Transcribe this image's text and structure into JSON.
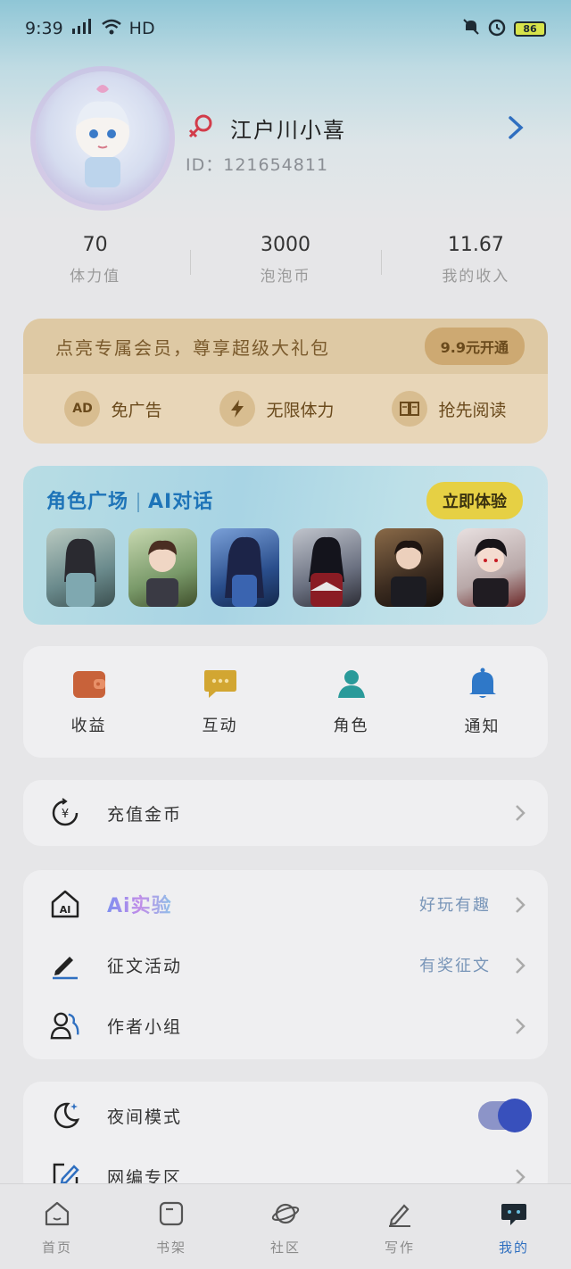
{
  "status_bar": {
    "time": "9:39",
    "network": "HD",
    "battery": "86"
  },
  "profile": {
    "nickname": "江户川小喜",
    "id_text": "ID：121654811"
  },
  "stats": [
    {
      "value": "70",
      "label": "体力值"
    },
    {
      "value": "3000",
      "label": "泡泡币"
    },
    {
      "value": "11.67",
      "label": "我的收入"
    }
  ],
  "vip": {
    "promo_text": "点亮专属会员，尊享超级大礼包",
    "button": "9.9元开通",
    "perks": [
      {
        "icon": "ad-icon",
        "icon_text": "AD",
        "label": "免广告"
      },
      {
        "icon": "lightning-icon",
        "label": "无限体力"
      },
      {
        "icon": "book-icon",
        "label": "抢先阅读"
      }
    ]
  },
  "role_plaza": {
    "title_left": "角色广场",
    "title_right": "AI对话",
    "button": "立即体验",
    "thumb_count": 6
  },
  "quick_actions": [
    {
      "label": "收益",
      "icon": "wallet-icon",
      "color": "#c8623a"
    },
    {
      "label": "互动",
      "icon": "chat-bubble-icon",
      "color": "#d2a632"
    },
    {
      "label": "角色",
      "icon": "person-icon",
      "color": "#2a9a9a"
    },
    {
      "label": "通知",
      "icon": "bell-icon",
      "color": "#2f78c8"
    }
  ],
  "recharge": {
    "label": "充值金币"
  },
  "feature_list": [
    {
      "label": "Ai实验",
      "extra": "好玩有趣",
      "icon": "ai-house-icon"
    },
    {
      "label": "征文活动",
      "extra": "有奖征文",
      "icon": "pen-icon"
    },
    {
      "label": "作者小组",
      "extra": "",
      "icon": "group-icon"
    }
  ],
  "settings": [
    {
      "label": "夜间模式",
      "icon": "moon-icon",
      "toggle_on": true
    },
    {
      "label": "网编专区",
      "icon": "edit-box-icon"
    }
  ],
  "bottom_nav": [
    {
      "label": "首页",
      "icon": "home-icon"
    },
    {
      "label": "书架",
      "icon": "shelf-icon"
    },
    {
      "label": "社区",
      "icon": "planet-icon"
    },
    {
      "label": "写作",
      "icon": "write-icon"
    },
    {
      "label": "我的",
      "icon": "me-icon",
      "active": true
    }
  ]
}
